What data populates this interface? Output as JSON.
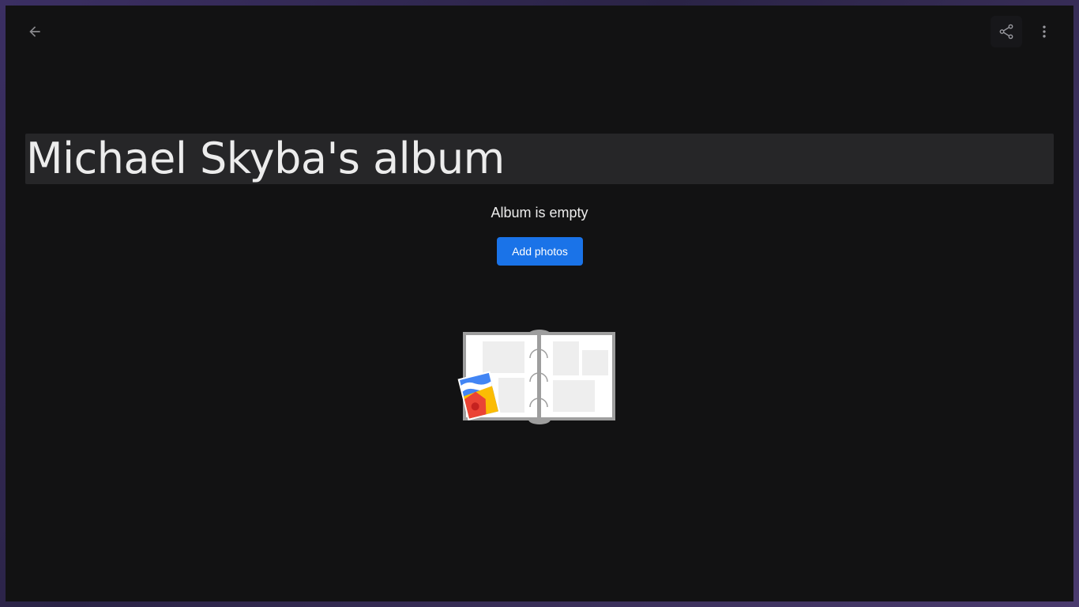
{
  "album": {
    "title": "Michael Skyba's album",
    "empty_message": "Album is empty",
    "add_photos_label": "Add photos"
  },
  "toolbar": {
    "back_icon": "arrow-left-icon",
    "share_icon": "share-icon",
    "more_icon": "more-vert-icon"
  },
  "colors": {
    "background": "#121213",
    "title_field": "#262628",
    "primary_button": "#1a73e8",
    "text": "#ececec"
  }
}
